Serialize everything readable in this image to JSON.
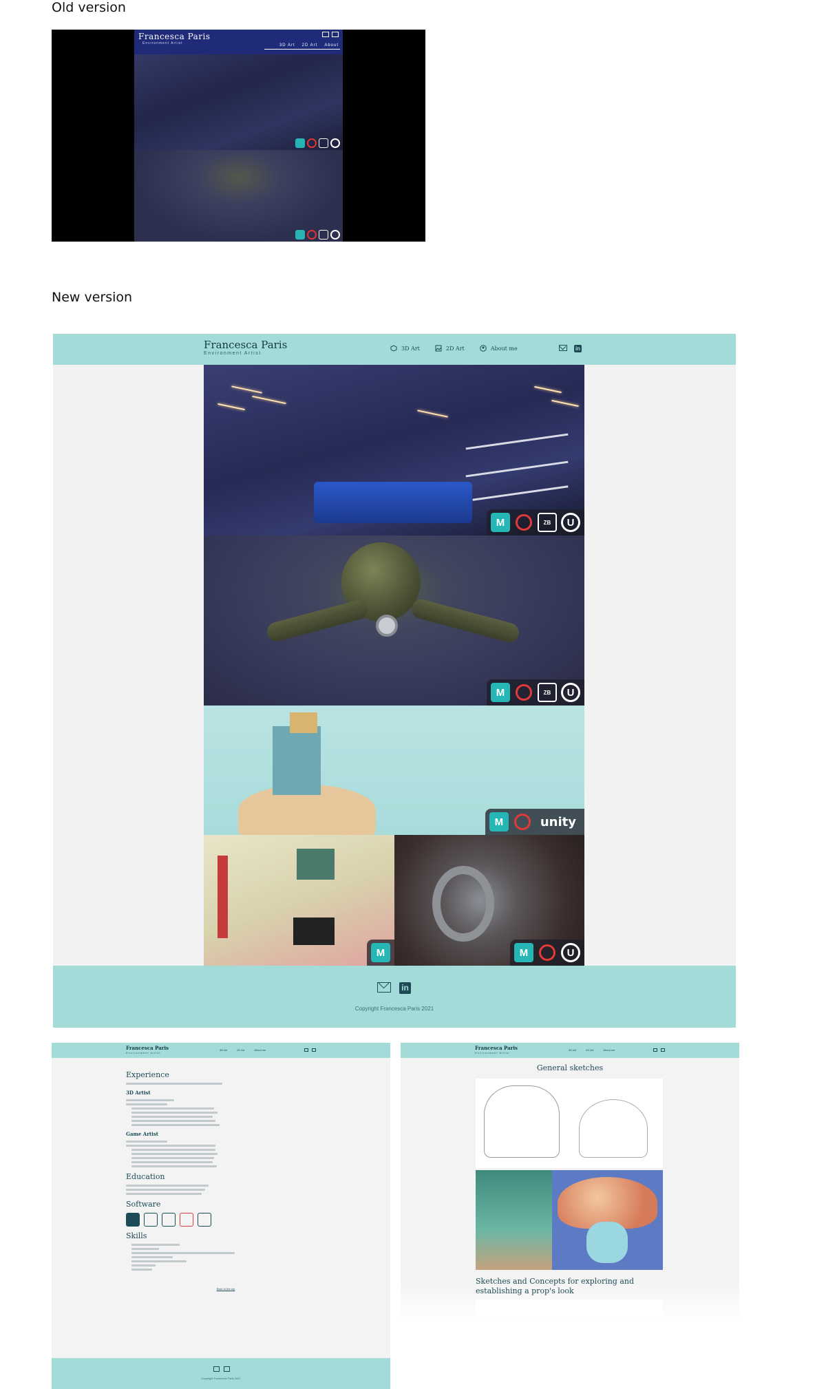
{
  "labels": {
    "old": "Old version",
    "new": "New version"
  },
  "old_site": {
    "logo": "Francesca Paris",
    "subtitle": "Environment Artist",
    "nav": [
      "3D Art",
      "2D Art",
      "About"
    ]
  },
  "new_site": {
    "logo": "Francesca Paris",
    "subtitle": "Environment Artist",
    "nav": [
      {
        "label": "3D Art",
        "icon": "cube-icon"
      },
      {
        "label": "2D Art",
        "icon": "image-icon"
      },
      {
        "label": "About me",
        "icon": "user-icon"
      }
    ],
    "social": [
      "mail-icon",
      "linkedin-icon"
    ],
    "gallery_badges": {
      "room": [
        "Maya",
        "Substance",
        "ZBrush",
        "Unreal"
      ],
      "robot": [
        "Maya",
        "Substance",
        "ZBrush",
        "Unreal"
      ],
      "island": [
        "Maya",
        "Substance",
        "unity"
      ],
      "coffee": [
        "Maya",
        "Substance",
        "Unreal"
      ],
      "bedroom": [
        "Maya"
      ]
    },
    "footer_copyright": "Copyright Francesca Paris 2021",
    "colors": {
      "accent": "#a3dbd8",
      "text_dark": "#133a44"
    }
  },
  "about_preview": {
    "logo": "Francesca Paris",
    "subtitle": "Environment Artist",
    "nav": [
      "3D Art",
      "2D Art",
      "About me"
    ],
    "experience_title": "Experience",
    "job1_title": "3D Artist",
    "job2_title": "Game Artist",
    "education_title": "Education",
    "software_title": "Software",
    "skills_title": "Skills",
    "back_to_top": "Back to the top",
    "copyright": "Copyright Francesca Paris 2021"
  },
  "gallery2d_preview": {
    "logo": "Francesca Paris",
    "subtitle": "Environment Artist",
    "nav": [
      "3D Art",
      "2D Art",
      "About me"
    ],
    "title": "General sketches",
    "caption": "Sketches and Concepts for exploring and establishing a prop's look"
  }
}
